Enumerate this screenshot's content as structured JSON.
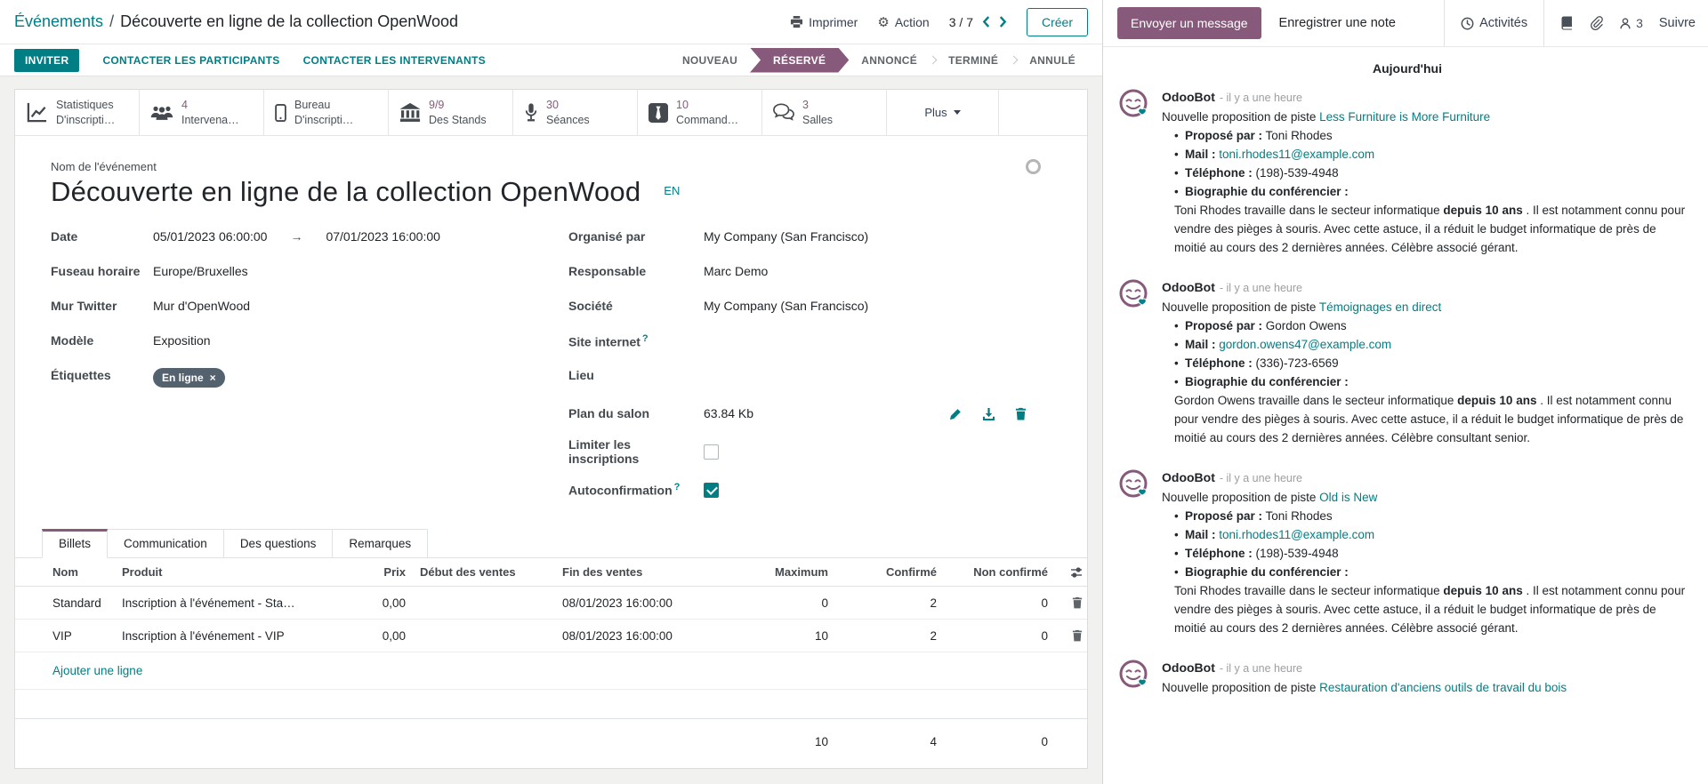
{
  "breadcrumb": {
    "section": "Événements",
    "separator": "/",
    "record": "Découverte en ligne de la collection OpenWood"
  },
  "topbar": {
    "print_label": "Imprimer",
    "action_label": "Action",
    "pager_value": "3 / 7",
    "create_label": "Créer"
  },
  "actionbar": {
    "invite": "INVITER",
    "contact_participants": "CONTACTER LES PARTICIPANTS",
    "contact_speakers": "CONTACTER LES INTERVENANTS",
    "statuses": [
      {
        "label": "NOUVEAU"
      },
      {
        "label": "RÉSERVÉ"
      },
      {
        "label": "ANNONCÉ"
      },
      {
        "label": "TERMINÉ"
      },
      {
        "label": "ANNULÉ"
      }
    ]
  },
  "stat_buttons": [
    {
      "top": "Statistiques",
      "bottom": "D'inscripti…"
    },
    {
      "top": "4",
      "bottom": "Intervena…"
    },
    {
      "top": "Bureau",
      "bottom": "D'inscripti…"
    },
    {
      "top": "9/9",
      "bottom": "Des Stands"
    },
    {
      "top": "30",
      "bottom": "Séances"
    },
    {
      "top": "10",
      "bottom": "Command…"
    },
    {
      "top": "3",
      "bottom": "Salles"
    }
  ],
  "more_label": "Plus",
  "form": {
    "name_label": "Nom de l'événement",
    "name_value": "Découverte en ligne de la collection OpenWood",
    "lang_badge": "EN",
    "date": {
      "label": "Date",
      "start": "05/01/2023 06:00:00",
      "arrow": "→",
      "end": "07/01/2023 16:00:00"
    },
    "timezone": {
      "label": "Fuseau horaire",
      "value": "Europe/Bruxelles"
    },
    "twitter": {
      "label": "Mur Twitter",
      "value": "Mur d'OpenWood"
    },
    "template": {
      "label": "Modèle",
      "value": "Exposition"
    },
    "tags": {
      "label": "Étiquettes",
      "tag": "En ligne",
      "remove": "×"
    },
    "organizer": {
      "label": "Organisé par",
      "value": "My Company (San Francisco)"
    },
    "responsible": {
      "label": "Responsable",
      "value": "Marc Demo"
    },
    "company": {
      "label": "Société",
      "value": "My Company (San Francisco)"
    },
    "website": {
      "label": "Site internet",
      "help": "?"
    },
    "venue": {
      "label": "Lieu"
    },
    "floorplan": {
      "label": "Plan du salon",
      "value": "63.84 Kb"
    },
    "limit": {
      "label": "Limiter les inscriptions"
    },
    "autoconfirm": {
      "label": "Autoconfirmation",
      "help": "?"
    }
  },
  "tabs": [
    {
      "label": "Billets"
    },
    {
      "label": "Communication"
    },
    {
      "label": "Des questions"
    },
    {
      "label": "Remarques"
    }
  ],
  "tickets": {
    "headers": {
      "name": "Nom",
      "product": "Produit",
      "price": "Prix",
      "start": "Début des ventes",
      "end": "Fin des ventes",
      "max": "Maximum",
      "confirmed": "Confirmé",
      "unconfirmed": "Non confirmé"
    },
    "rows": [
      {
        "name": "Standard",
        "product": "Inscription à l'événement - Sta…",
        "price": "0,00",
        "start": "",
        "end": "08/01/2023 16:00:00",
        "max": "0",
        "confirmed": "2",
        "unconfirmed": "0"
      },
      {
        "name": "VIP",
        "product": "Inscription à l'événement - VIP",
        "price": "0,00",
        "start": "",
        "end": "08/01/2023 16:00:00",
        "max": "10",
        "confirmed": "2",
        "unconfirmed": "0"
      }
    ],
    "add_line": "Ajouter une ligne",
    "totals": {
      "max": "10",
      "confirmed": "4",
      "unconfirmed": "0"
    }
  },
  "chatter": {
    "send": "Envoyer un message",
    "note": "Enregistrer une note",
    "activities": "Activités",
    "followers_count": "3",
    "follow": "Suivre",
    "today": "Aujourd'hui",
    "messages": [
      {
        "author": "OdooBot",
        "time": "- il y a une heure",
        "intro": "Nouvelle proposition de piste",
        "link": "Less Furniture is More Furniture",
        "b0_label": "Proposé par :",
        "b0_text": "Toni Rhodes",
        "b1_label": "Mail :",
        "b1_link": "toni.rhodes11@example.com",
        "b2_label": "Téléphone :",
        "b2_text": "(198)-539-4948",
        "b3_label": "Biographie du conférencier :",
        "bio_pre": "Toni Rhodes travaille dans le secteur informatique ",
        "bio_bold": "depuis 10 ans",
        "bio_post": " . Il est notamment connu pour vendre des pièges à souris. Avec cette astuce, il a réduit le budget informatique de près de moitié au cours des 2 dernières années. Célèbre associé gérant."
      },
      {
        "author": "OdooBot",
        "time": "- il y a une heure",
        "intro": "Nouvelle proposition de piste",
        "link": "Témoignages en direct",
        "b0_label": "Proposé par :",
        "b0_text": "Gordon Owens",
        "b1_label": "Mail :",
        "b1_link": "gordon.owens47@example.com",
        "b2_label": "Téléphone :",
        "b2_text": "(336)-723-6569",
        "b3_label": "Biographie du conférencier :",
        "bio_pre": "Gordon Owens travaille dans le secteur informatique ",
        "bio_bold": "depuis 10 ans",
        "bio_post": " . Il est notamment connu pour vendre des pièges à souris. Avec cette astuce, il a réduit le budget informatique de près de moitié au cours des 2 dernières années. Célèbre consultant senior."
      },
      {
        "author": "OdooBot",
        "time": "- il y a une heure",
        "intro": "Nouvelle proposition de piste",
        "link": "Old is New",
        "b0_label": "Proposé par :",
        "b0_text": "Toni Rhodes",
        "b1_label": "Mail :",
        "b1_link": "toni.rhodes11@example.com",
        "b2_label": "Téléphone :",
        "b2_text": "(198)-539-4948",
        "b3_label": "Biographie du conférencier :",
        "bio_pre": "Toni Rhodes travaille dans le secteur informatique ",
        "bio_bold": "depuis 10 ans",
        "bio_post": " . Il est notamment connu pour vendre des pièges à souris. Avec cette astuce, il a réduit le budget informatique de près de moitié au cours des 2 dernières années. Célèbre associé gérant."
      },
      {
        "author": "OdooBot",
        "time": "- il y a une heure",
        "intro": "Nouvelle proposition de piste",
        "link": "Restauration d'anciens outils de travail du bois"
      }
    ]
  }
}
